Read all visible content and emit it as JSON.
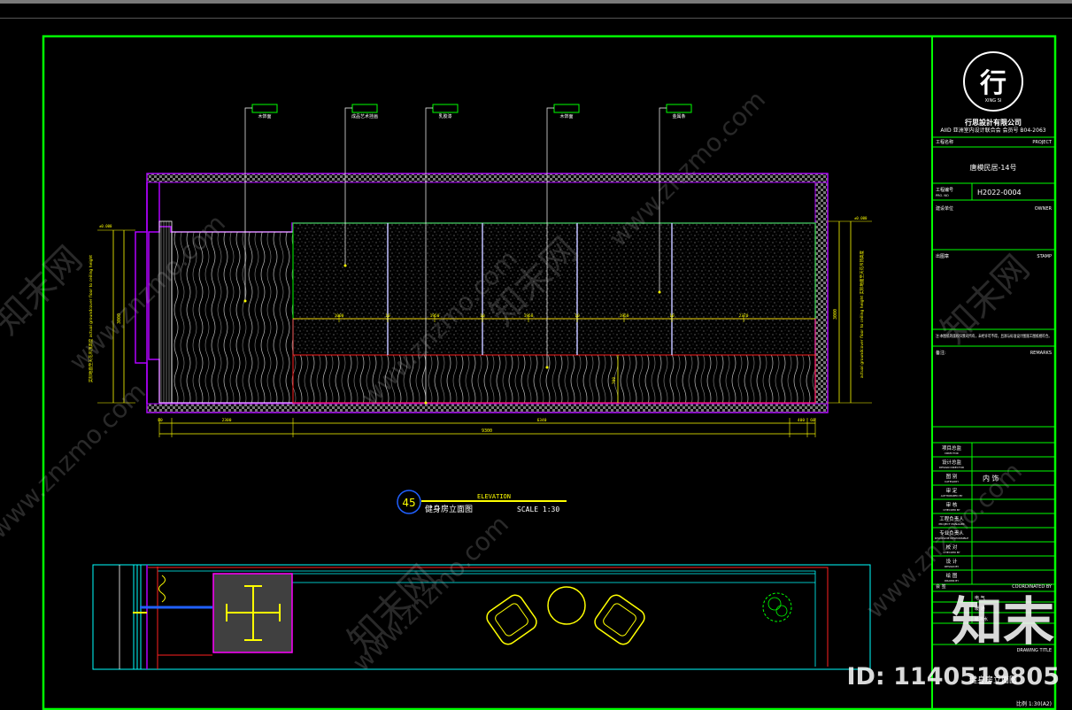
{
  "title_block": {
    "logo_char": "行",
    "logo_caption": "XING SI",
    "company": "行思設計有限公司",
    "company_sub": "AIID 亚洲室内设计联合会 会员号 B04-2063",
    "project_label_cn": "工程名称",
    "project_label_en": "PROJECT",
    "project_name": "唐模民居-14号",
    "project_no_label": "工程编号",
    "project_no_label_en": "PRO. NO",
    "project_no": "H2022-0004",
    "owner_label": "建设单位",
    "owner_label_en": "OWNER",
    "stamp_label": "出图章",
    "stamp_label_en": "STAMP",
    "note_text": "注:本图纸的版权归我司所有，未经许可不得，且须与标准设计图施工图纸相符合。",
    "remarks_label": "备注:",
    "remarks_label_en": "REMARKS",
    "sign_rows": [
      {
        "cn": "项目总监",
        "en": "DIRECTOR",
        "value": ""
      },
      {
        "cn": "设计总监",
        "en": "DESIGN DIRECTOR",
        "value": ""
      },
      {
        "cn": "图 别",
        "en": "CATEGORY",
        "value": "内 饰"
      },
      {
        "cn": "审 定",
        "en": "AUTHORIZED BY",
        "value": ""
      },
      {
        "cn": "审 核",
        "en": "CHECKED BY",
        "value": ""
      },
      {
        "cn": "工程负责人",
        "en": "PROJECT MANAGER",
        "value": ""
      },
      {
        "cn": "专业负责人",
        "en": "DISCIPLINE RESPONSIBLE",
        "value": ""
      },
      {
        "cn": "校 对",
        "en": "CHECKED BY",
        "value": ""
      },
      {
        "cn": "设 计",
        "en": "DESIGN BY",
        "value": ""
      },
      {
        "cn": "绘 图",
        "en": "DRAWN BY",
        "value": ""
      }
    ],
    "coord_label": "会 签",
    "coord_label_en": "COORDINATED BY",
    "coord_rows": [
      "电 气",
      "暖 通",
      "给排水"
    ],
    "drawing_title_label": "DRAWING TITLE",
    "drawing_title": "健身房立面图",
    "scale_text": "比例 1:30(A2)"
  },
  "elevation": {
    "number": "45",
    "en_title": "ELEVATION",
    "cn_title": "健身房立面图",
    "scale": "SCALE 1:30",
    "callouts": [
      "木饰面",
      "成品艺术挂画",
      "乳胶漆",
      "木饰面",
      "金属条"
    ],
    "top_dims": [
      "1000",
      "10",
      "1950",
      "10",
      "1950",
      "10",
      "1950",
      "10",
      "2370"
    ],
    "bottom_dims": [
      "80",
      "2300",
      "6340",
      "400",
      "60"
    ],
    "total_dim": "9300",
    "left_height_label": "3000",
    "right_height_label": "3000",
    "left_note": "实际地面至天花吊顶高度 actual groundcover floor to ceiling height",
    "right_note": "actual groundcover floor to ceiling height 实际地面至天花吊顶高度",
    "level_tag": "±0.000",
    "wainscot_dim": "700"
  },
  "watermark": {
    "brand": "知末",
    "id_text": "ID: 1140519805",
    "url": "www.znzmo.com",
    "site_cn": "知末网"
  },
  "colors": {
    "frame": "#00ff00",
    "purple": "#b000ff",
    "magenta": "#ff00ff",
    "cyan": "#00ffff",
    "yellow": "#ffff00",
    "red": "#ff2020",
    "white": "#ffffff"
  }
}
